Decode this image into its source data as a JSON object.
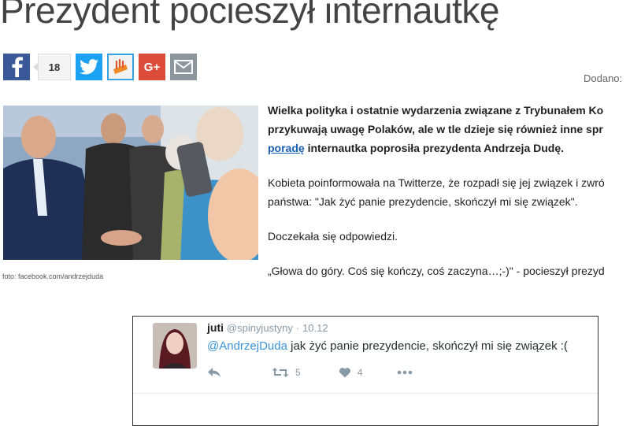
{
  "article": {
    "title": "Prezydent pocieszył internautkę",
    "added_label": "Dodano:",
    "photo_caption": "foto: facebook.com/andrzejduda",
    "lead": {
      "line1": "Wielka polityka i ostatnie wydarzenia związane z Trybunałem Ko",
      "line2": "przykuwają uwagę Polaków, ale w tle dzieje się również inne spr",
      "link_text": "poradę",
      "line3_rest": " internautka poprosiła prezydenta Andrzeja Dudę."
    },
    "para1": {
      "line1": "Kobieta poinformowała na Twitterze, że rozpadł się jej związek i zwró",
      "line2": "państwa: \"Jak żyć panie prezydencie, skończył mi się związek\"."
    },
    "para2": "Doczekała się odpowiedzi.",
    "para3": "„Głowa do góry. Coś się kończy, coś zaczyna…;-)\" - pocieszył prezyd"
  },
  "share": {
    "facebook_icon": "facebook-icon",
    "count": "18",
    "twitter_icon": "twitter-icon",
    "wykop_icon": "wykop-icon",
    "googleplus_icon": "google-plus-icon",
    "googleplus_label": "G+",
    "email_icon": "email-icon",
    "colors": {
      "facebook": "#3b5998",
      "twitter": "#1da1f2",
      "googleplus": "#dd4b39",
      "email": "#8c969d"
    }
  },
  "tweet": {
    "author": "juti",
    "handle": "@spinyjustyny",
    "separator": "·",
    "date": "10.12",
    "mention": "@AndrzejDuda",
    "text": " jak żyć panie prezydencie, skończył mi się związek :(",
    "retweets": "5",
    "likes": "4",
    "mention_color": "#3b94d9"
  }
}
